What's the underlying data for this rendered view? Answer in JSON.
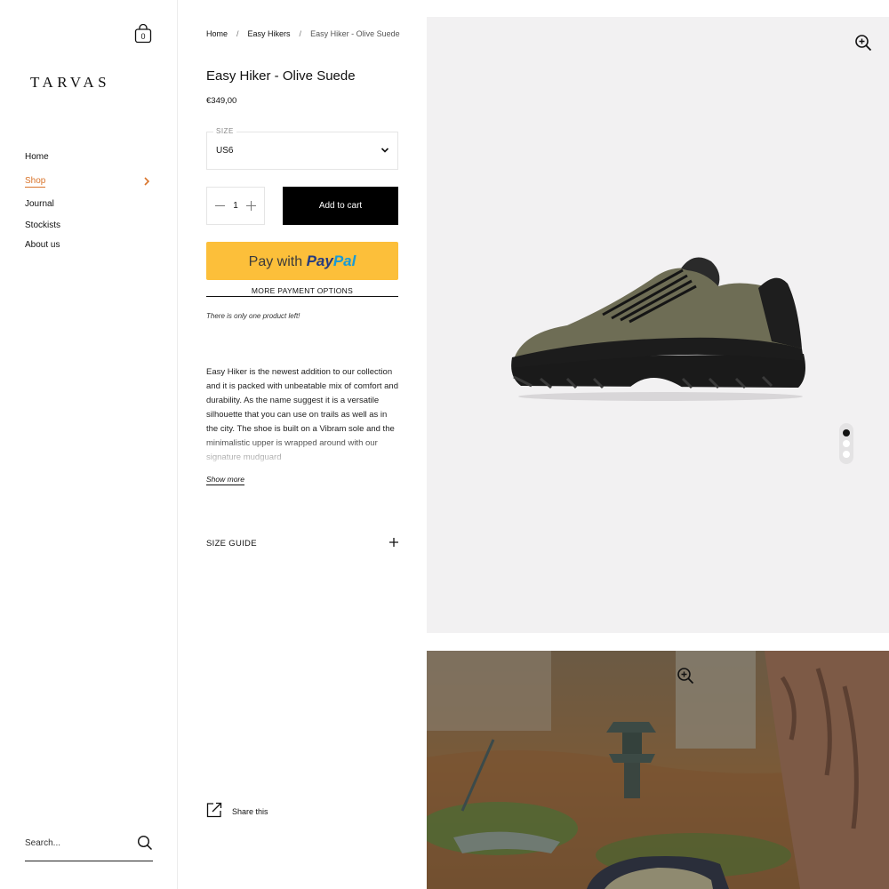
{
  "brand": {
    "logo_text": "TARVAS"
  },
  "cart": {
    "count": "0"
  },
  "sidebar": {
    "items": [
      {
        "label": "Home",
        "active": false
      },
      {
        "label": "Shop",
        "active": true
      },
      {
        "label": "Journal",
        "active": false
      },
      {
        "label": "Stockists",
        "active": false
      },
      {
        "label": "About us",
        "active": false
      }
    ],
    "search_placeholder": "Search..."
  },
  "breadcrumb": {
    "home": "Home",
    "sep": "/",
    "collection": "Easy Hikers",
    "current": "Easy Hiker - Olive Suede"
  },
  "product": {
    "title": "Easy Hiker - Olive Suede",
    "price": "€349,00",
    "size_label": "SIZE",
    "size_value": "US6",
    "quantity": "1",
    "add_to_cart": "Add to cart",
    "paypal_prefix": "Pay with",
    "paypal_brand_1": "Pay",
    "paypal_brand_2": "Pal",
    "more_payment": "MORE PAYMENT OPTIONS",
    "stock_note": "There is only one product left!",
    "description": "Easy Hiker is the newest addition to our collection and it is packed with unbeatable mix of comfort and durability. As the name suggest it is a versatile silhouette that you can use on trails as well as in the city. The shoe is built on a Vibram sole and the minimalistic upper is wrapped around with our signature mudguard",
    "show_more": "Show more",
    "size_guide": "SIZE GUIDE",
    "share": "Share this"
  },
  "gallery": {
    "slide_count": 3,
    "active_slide": 1
  },
  "colors": {
    "accent": "#d9742b",
    "paypal_yellow": "#fcbf3a",
    "gallery_bg": "#f2f1f2"
  }
}
